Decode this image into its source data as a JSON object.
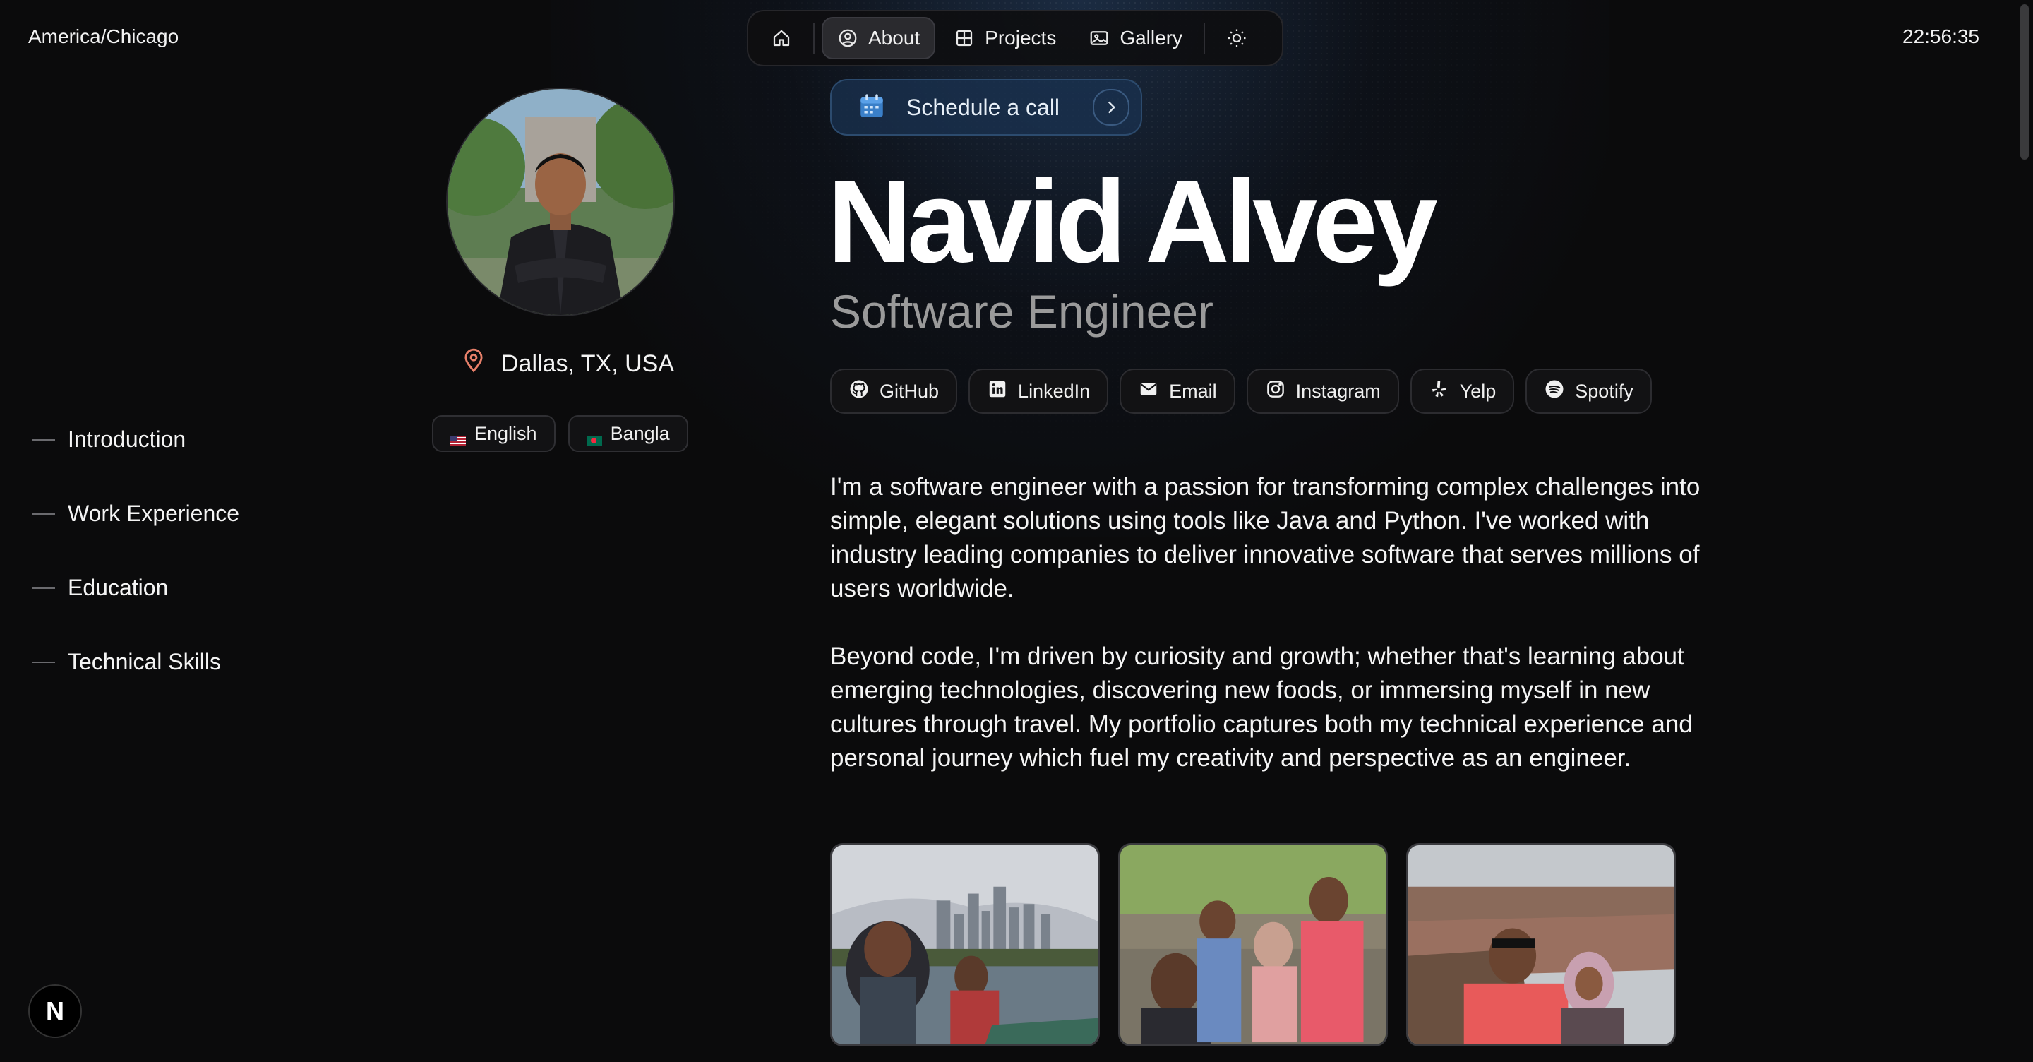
{
  "header": {
    "timezone": "America/Chicago",
    "clock": "22:56:35"
  },
  "nav": {
    "items": [
      {
        "label": "",
        "icon": "home-icon"
      },
      {
        "label": "About",
        "icon": "person-circle-icon",
        "active": true
      },
      {
        "label": "Projects",
        "icon": "grid-icon"
      },
      {
        "label": "Gallery",
        "icon": "image-icon"
      },
      {
        "label": "",
        "icon": "sun-icon"
      }
    ]
  },
  "profile": {
    "location": "Dallas, TX, USA",
    "languages": [
      {
        "label": "English",
        "flag": "us-flag-icon"
      },
      {
        "label": "Bangla",
        "flag": "bd-flag-icon"
      }
    ]
  },
  "toc": {
    "items": [
      {
        "label": "Introduction"
      },
      {
        "label": "Work Experience"
      },
      {
        "label": "Education"
      },
      {
        "label": "Technical Skills"
      }
    ]
  },
  "hero": {
    "schedule_label": "Schedule a call",
    "name": "Navid Alvey",
    "role": "Software Engineer"
  },
  "socials": [
    {
      "label": "GitHub",
      "icon": "github-icon"
    },
    {
      "label": "LinkedIn",
      "icon": "linkedin-icon"
    },
    {
      "label": "Email",
      "icon": "mail-icon"
    },
    {
      "label": "Instagram",
      "icon": "instagram-icon"
    },
    {
      "label": "Yelp",
      "icon": "yelp-icon"
    },
    {
      "label": "Spotify",
      "icon": "spotify-icon"
    }
  ],
  "bio": {
    "p1": "I'm a software engineer with a passion for transforming complex challenges into simple, elegant solutions using tools like Java and Python. I've worked with industry leading companies to deliver innovative software that serves millions of users worldwide.",
    "p2": "Beyond code, I'm driven by curiosity and growth; whether that's learning about emerging technologies, discovering new foods, or immersing myself in new cultures through travel. My portfolio captures both my technical experience and personal journey which fuel my creativity and perspective as an engineer."
  },
  "badge": {
    "letter": "N"
  },
  "colors": {
    "background": "#0b0b0c",
    "accent_blue": "#2c4b6e",
    "location_pin": "#e8806a"
  }
}
